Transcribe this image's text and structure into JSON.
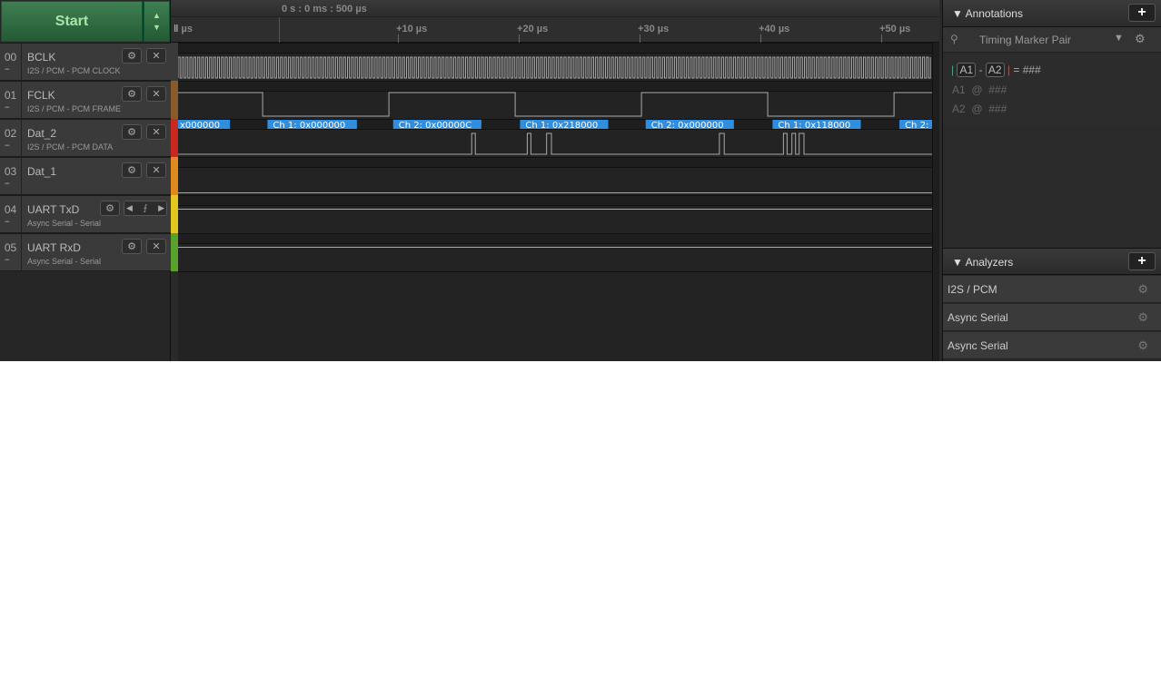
{
  "toolbar": {
    "start_label": "Start",
    "up_icon": "▲",
    "down_icon": "▼"
  },
  "ruler": {
    "marker_label": "0 s : 0 ms : 500 µs",
    "left_label": "µs",
    "ticks": [
      {
        "t": 10,
        "label": "+10 µs"
      },
      {
        "t": 20,
        "label": "+20 µs"
      },
      {
        "t": 30,
        "label": "+30 µs"
      },
      {
        "t": 40,
        "label": "+40 µs"
      },
      {
        "t": 50,
        "label": "+50 µs"
      }
    ]
  },
  "channels": [
    {
      "num": "00",
      "name": "BCLK",
      "sub": "I2S / PCM - PCM CLOCK",
      "color": "#3a3a3a"
    },
    {
      "num": "01",
      "name": "FCLK",
      "sub": "I2S / PCM - PCM FRAME",
      "color": "#8b5a2b"
    },
    {
      "num": "02",
      "name": "Dat_2",
      "sub": "I2S / PCM - PCM DATA",
      "color": "#c8281e"
    },
    {
      "num": "03",
      "name": "Dat_1",
      "sub": "",
      "color": "#e08a1e"
    },
    {
      "num": "04",
      "name": "UART TxD",
      "sub": "Async Serial - Serial",
      "color": "#e0c81e"
    },
    {
      "num": "05",
      "name": "UART RxD",
      "sub": "Async Serial - Serial",
      "color": "#5aa02c"
    }
  ],
  "signals": {
    "view_start_us": -8.2,
    "view_end_us": 54.2,
    "bclk_period_us": 0.326,
    "fclk_initial": 1,
    "fclk_edges_us": [
      -1.2,
      9.25,
      19.7,
      30.15,
      40.6,
      51.05
    ],
    "dat2_pulses_us": [
      [
        16.1,
        16.4
      ],
      [
        20.7,
        21.0
      ],
      [
        22.3,
        22.7
      ],
      [
        36.6,
        37.0
      ],
      [
        41.9,
        42.2
      ],
      [
        42.6,
        42.9
      ],
      [
        43.2,
        43.6
      ]
    ],
    "decodes": [
      {
        "start": -8.2,
        "end": -3.9,
        "label": "x000000"
      },
      {
        "start": -0.8,
        "end": 6.6,
        "label": "Ch 1: 0x000000"
      },
      {
        "start": 9.6,
        "end": 16.9,
        "label": "Ch 2: 0x00000C"
      },
      {
        "start": 20.1,
        "end": 27.4,
        "label": "Ch 1: 0x218000"
      },
      {
        "start": 30.5,
        "end": 37.8,
        "label": "Ch 2: 0x000000"
      },
      {
        "start": 41.0,
        "end": 48.3,
        "label": "Ch 1: 0x118000"
      },
      {
        "start": 51.5,
        "end": 54.2,
        "label": "Ch 2:"
      }
    ],
    "decode_color": "#2f8ee0"
  },
  "annotations": {
    "title": "Annotations",
    "add": "+",
    "marker_type": "Timing Marker Pair",
    "pipe": "|",
    "a1": "A1",
    "a2": "A2",
    "minus": "-",
    "equals": "=",
    "value": "###",
    "at": "@",
    "a1_value": "###",
    "a2_value": "###"
  },
  "analyzers": {
    "title": "Analyzers",
    "add": "+",
    "items": [
      "I2S / PCM",
      "Async Serial",
      "Async Serial"
    ]
  }
}
